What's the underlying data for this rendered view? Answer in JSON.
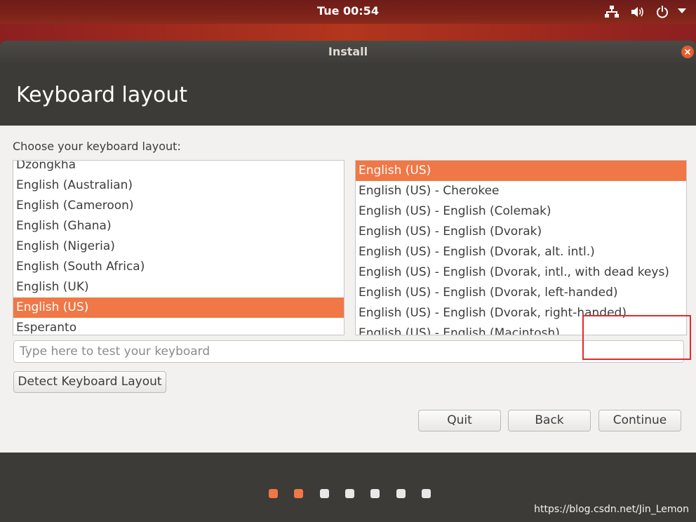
{
  "topbar": {
    "clock": "Tue 00:54",
    "icons": [
      "network-icon",
      "volume-icon",
      "power-icon",
      "chevron-down-icon"
    ]
  },
  "window": {
    "title": "Install",
    "heading": "Keyboard layout"
  },
  "layout": {
    "prompt": "Choose your keyboard layout:",
    "layouts": [
      {
        "label": "Dzongkha",
        "selected": false
      },
      {
        "label": "English (Australian)",
        "selected": false
      },
      {
        "label": "English (Cameroon)",
        "selected": false
      },
      {
        "label": "English (Ghana)",
        "selected": false
      },
      {
        "label": "English (Nigeria)",
        "selected": false
      },
      {
        "label": "English (South Africa)",
        "selected": false
      },
      {
        "label": "English (UK)",
        "selected": false
      },
      {
        "label": "English (US)",
        "selected": true
      },
      {
        "label": "Esperanto",
        "selected": false
      }
    ],
    "variants": [
      {
        "label": "English (US)",
        "selected": true
      },
      {
        "label": "English (US) - Cherokee",
        "selected": false
      },
      {
        "label": "English (US) - English (Colemak)",
        "selected": false
      },
      {
        "label": "English (US) - English (Dvorak)",
        "selected": false
      },
      {
        "label": "English (US) - English (Dvorak, alt. intl.)",
        "selected": false
      },
      {
        "label": "English (US) - English (Dvorak, intl., with dead keys)",
        "selected": false
      },
      {
        "label": "English (US) - English (Dvorak, left-handed)",
        "selected": false
      },
      {
        "label": "English (US) - English (Dvorak, right-handed)",
        "selected": false
      },
      {
        "label": "English (US) - English (Macintosh)",
        "selected": false
      }
    ],
    "test_placeholder": "Type here to test your keyboard",
    "test_value": "",
    "detect_label": "Detect Keyboard Layout"
  },
  "buttons": {
    "quit": "Quit",
    "back": "Back",
    "continue": "Continue"
  },
  "progress": {
    "total_steps": 7,
    "completed_steps": 2
  },
  "colors": {
    "accent": "#f07746",
    "annotation": "#e02b2b",
    "dot_inactive": "#e8e8e8"
  },
  "watermark": "https://blog.csdn.net/Jin_Lemon"
}
